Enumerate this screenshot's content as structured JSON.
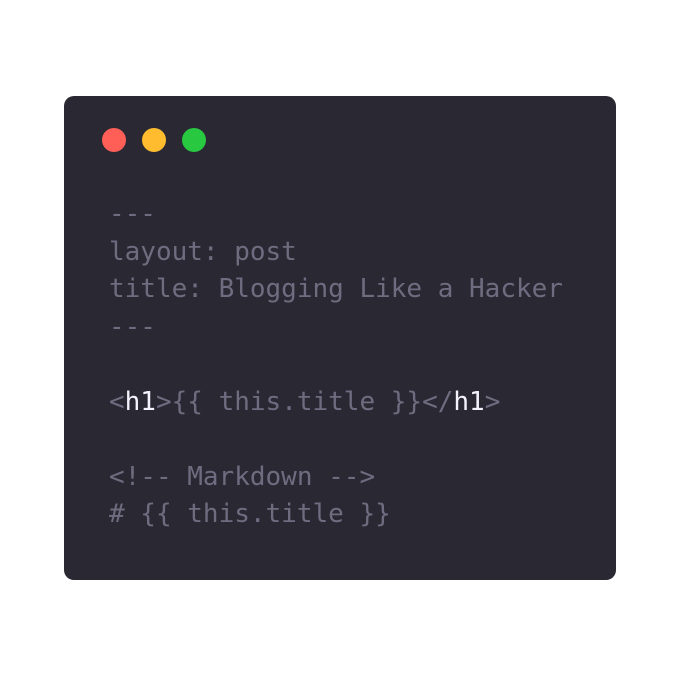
{
  "window": {
    "background": "#2a2833",
    "traffic_lights": [
      {
        "name": "close",
        "color": "#ff5f57"
      },
      {
        "name": "minimize",
        "color": "#febc2e"
      },
      {
        "name": "maximize",
        "color": "#28c840"
      }
    ]
  },
  "code": {
    "text_color": "#6f6c80",
    "tag_color": "#f4f2fb",
    "lines": {
      "fm_open": "---",
      "layout": "layout: post",
      "title": "title: Blogging Like a Hacker",
      "fm_close": "---",
      "h1_lt": "<",
      "h1_open_tag": "h1",
      "h1_mid": ">{{ this.title }}</",
      "h1_close_tag": "h1",
      "h1_gt": ">",
      "comment": "<!-- Markdown -->",
      "heading": "# {{ this.title }}"
    }
  }
}
